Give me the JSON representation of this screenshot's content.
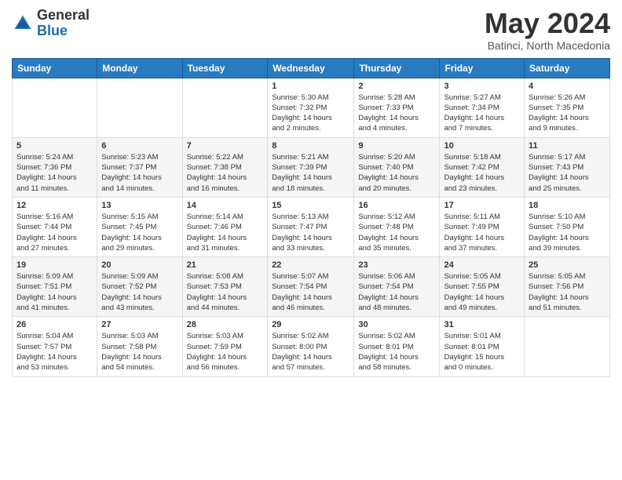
{
  "header": {
    "logo_general": "General",
    "logo_blue": "Blue",
    "month_title": "May 2024",
    "location": "Batinci, North Macedonia"
  },
  "calendar": {
    "days_of_week": [
      "Sunday",
      "Monday",
      "Tuesday",
      "Wednesday",
      "Thursday",
      "Friday",
      "Saturday"
    ],
    "weeks": [
      [
        {
          "num": "",
          "info": ""
        },
        {
          "num": "",
          "info": ""
        },
        {
          "num": "",
          "info": ""
        },
        {
          "num": "1",
          "info": "Sunrise: 5:30 AM\nSunset: 7:32 PM\nDaylight: 14 hours\nand 2 minutes."
        },
        {
          "num": "2",
          "info": "Sunrise: 5:28 AM\nSunset: 7:33 PM\nDaylight: 14 hours\nand 4 minutes."
        },
        {
          "num": "3",
          "info": "Sunrise: 5:27 AM\nSunset: 7:34 PM\nDaylight: 14 hours\nand 7 minutes."
        },
        {
          "num": "4",
          "info": "Sunrise: 5:26 AM\nSunset: 7:35 PM\nDaylight: 14 hours\nand 9 minutes."
        }
      ],
      [
        {
          "num": "5",
          "info": "Sunrise: 5:24 AM\nSunset: 7:36 PM\nDaylight: 14 hours\nand 11 minutes."
        },
        {
          "num": "6",
          "info": "Sunrise: 5:23 AM\nSunset: 7:37 PM\nDaylight: 14 hours\nand 14 minutes."
        },
        {
          "num": "7",
          "info": "Sunrise: 5:22 AM\nSunset: 7:38 PM\nDaylight: 14 hours\nand 16 minutes."
        },
        {
          "num": "8",
          "info": "Sunrise: 5:21 AM\nSunset: 7:39 PM\nDaylight: 14 hours\nand 18 minutes."
        },
        {
          "num": "9",
          "info": "Sunrise: 5:20 AM\nSunset: 7:40 PM\nDaylight: 14 hours\nand 20 minutes."
        },
        {
          "num": "10",
          "info": "Sunrise: 5:18 AM\nSunset: 7:42 PM\nDaylight: 14 hours\nand 23 minutes."
        },
        {
          "num": "11",
          "info": "Sunrise: 5:17 AM\nSunset: 7:43 PM\nDaylight: 14 hours\nand 25 minutes."
        }
      ],
      [
        {
          "num": "12",
          "info": "Sunrise: 5:16 AM\nSunset: 7:44 PM\nDaylight: 14 hours\nand 27 minutes."
        },
        {
          "num": "13",
          "info": "Sunrise: 5:15 AM\nSunset: 7:45 PM\nDaylight: 14 hours\nand 29 minutes."
        },
        {
          "num": "14",
          "info": "Sunrise: 5:14 AM\nSunset: 7:46 PM\nDaylight: 14 hours\nand 31 minutes."
        },
        {
          "num": "15",
          "info": "Sunrise: 5:13 AM\nSunset: 7:47 PM\nDaylight: 14 hours\nand 33 minutes."
        },
        {
          "num": "16",
          "info": "Sunrise: 5:12 AM\nSunset: 7:48 PM\nDaylight: 14 hours\nand 35 minutes."
        },
        {
          "num": "17",
          "info": "Sunrise: 5:11 AM\nSunset: 7:49 PM\nDaylight: 14 hours\nand 37 minutes."
        },
        {
          "num": "18",
          "info": "Sunrise: 5:10 AM\nSunset: 7:50 PM\nDaylight: 14 hours\nand 39 minutes."
        }
      ],
      [
        {
          "num": "19",
          "info": "Sunrise: 5:09 AM\nSunset: 7:51 PM\nDaylight: 14 hours\nand 41 minutes."
        },
        {
          "num": "20",
          "info": "Sunrise: 5:09 AM\nSunset: 7:52 PM\nDaylight: 14 hours\nand 43 minutes."
        },
        {
          "num": "21",
          "info": "Sunrise: 5:08 AM\nSunset: 7:53 PM\nDaylight: 14 hours\nand 44 minutes."
        },
        {
          "num": "22",
          "info": "Sunrise: 5:07 AM\nSunset: 7:54 PM\nDaylight: 14 hours\nand 46 minutes."
        },
        {
          "num": "23",
          "info": "Sunrise: 5:06 AM\nSunset: 7:54 PM\nDaylight: 14 hours\nand 48 minutes."
        },
        {
          "num": "24",
          "info": "Sunrise: 5:05 AM\nSunset: 7:55 PM\nDaylight: 14 hours\nand 49 minutes."
        },
        {
          "num": "25",
          "info": "Sunrise: 5:05 AM\nSunset: 7:56 PM\nDaylight: 14 hours\nand 51 minutes."
        }
      ],
      [
        {
          "num": "26",
          "info": "Sunrise: 5:04 AM\nSunset: 7:57 PM\nDaylight: 14 hours\nand 53 minutes."
        },
        {
          "num": "27",
          "info": "Sunrise: 5:03 AM\nSunset: 7:58 PM\nDaylight: 14 hours\nand 54 minutes."
        },
        {
          "num": "28",
          "info": "Sunrise: 5:03 AM\nSunset: 7:59 PM\nDaylight: 14 hours\nand 56 minutes."
        },
        {
          "num": "29",
          "info": "Sunrise: 5:02 AM\nSunset: 8:00 PM\nDaylight: 14 hours\nand 57 minutes."
        },
        {
          "num": "30",
          "info": "Sunrise: 5:02 AM\nSunset: 8:01 PM\nDaylight: 14 hours\nand 58 minutes."
        },
        {
          "num": "31",
          "info": "Sunrise: 5:01 AM\nSunset: 8:01 PM\nDaylight: 15 hours\nand 0 minutes."
        },
        {
          "num": "",
          "info": ""
        }
      ]
    ]
  }
}
